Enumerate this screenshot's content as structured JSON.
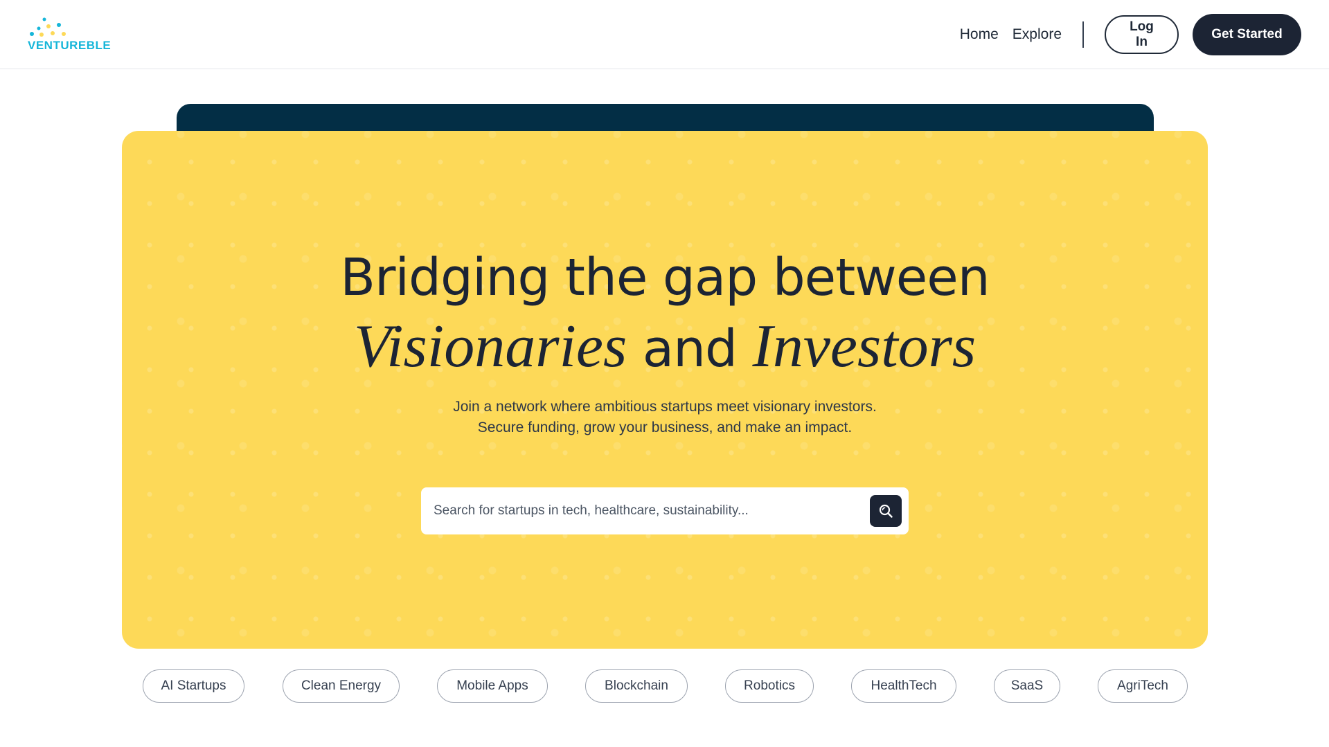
{
  "brand": {
    "name": "VENTUREBLE",
    "color": "#16b6d9",
    "accent_yellow": "#fdd958",
    "dark": "#1c2434"
  },
  "nav": {
    "home": "Home",
    "explore": "Explore",
    "login": "Log In",
    "get_started": "Get Started"
  },
  "hero": {
    "title_line1": "Bridging the gap between",
    "title_word1": "Visionaries",
    "title_and": "and",
    "title_word2": "Investors",
    "subtitle": "Join a network where ambitious startups meet visionary investors. Secure funding, grow your business, and make an impact.",
    "search": {
      "placeholder": "Search for startups in tech, healthcare, sustainability...",
      "value": "",
      "button_icon": "search-icon"
    }
  },
  "categories": [
    "AI Startups",
    "Clean Energy",
    "Mobile Apps",
    "Blockchain",
    "Robotics",
    "HealthTech",
    "SaaS",
    "AgriTech"
  ]
}
